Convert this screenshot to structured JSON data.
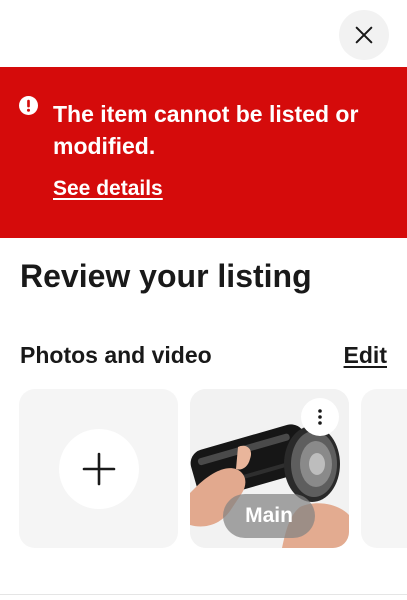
{
  "header": {
    "close_icon": "close-icon"
  },
  "alert": {
    "background": "#d50b0b",
    "icon": "exclamation-icon",
    "message": "The item cannot be listed or modified.",
    "link_label": "See details"
  },
  "page": {
    "title": "Review your listing"
  },
  "photos_section": {
    "title": "Photos and video",
    "edit_label": "Edit",
    "add_icon": "plus-icon",
    "main_badge": "Main",
    "more_icon": "more-vertical-icon"
  }
}
